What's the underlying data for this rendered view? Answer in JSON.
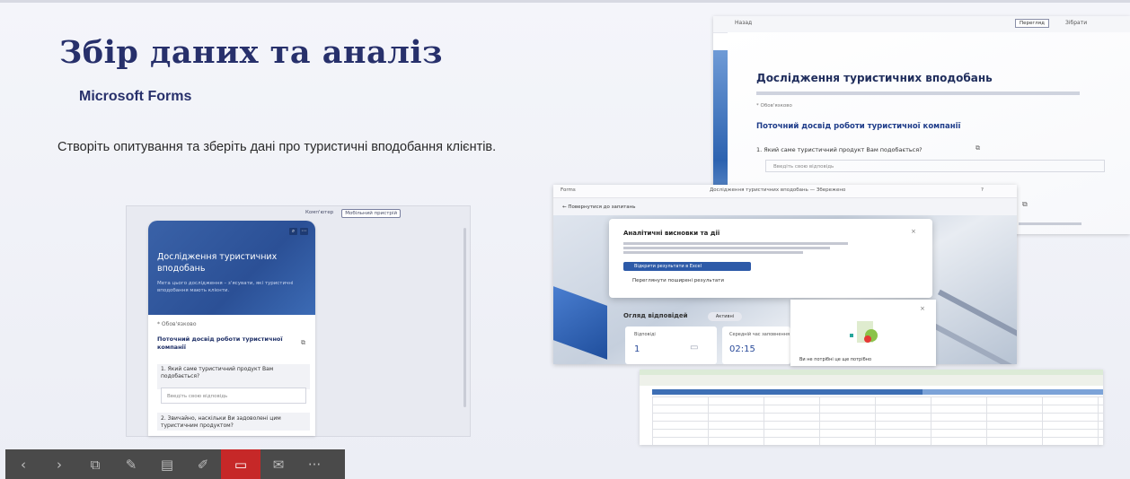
{
  "slide": {
    "title": "Збір даних та аналіз",
    "subtitle": "Microsoft Forms",
    "body": "Створіть опитування та зберіть дані про туристичні вподобання клієнтів."
  },
  "phone_preview": {
    "tab_computer": "Комп'ютер",
    "tab_mobile": "Мобільний пристрій",
    "form_title": "Дослідження туристичних вподобань",
    "form_desc": "Мета цього дослідження – з'ясувати, які туристичні вподобання мають клієнти.",
    "required_note": "* Обов'язково",
    "section_title": "Поточний досвід роботи туристичної компанії",
    "q1": "1. Який саме туристичний продукт Вам подобається?",
    "answer_placeholder": "Введіть свою відповідь",
    "q2": "2. Звичайно, наскільки Ви задоволені цим туристичним продуктом?"
  },
  "form_screenshot": {
    "top_left": "Назад",
    "preview_button": "Перегляд",
    "top_right": "Зібрати",
    "title": "Дослідження туристичних вподобань",
    "required_note": "* Обов'язково",
    "section_title": "Поточний досвід роботи туристичної компанії",
    "q1": "1. Який саме туристичний продукт Вам подобається?",
    "answer_placeholder": "Введіть свою відповідь"
  },
  "dashboard": {
    "top_left": "Forms",
    "top_mid": "Дослідження туристичних вподобань — Збережено",
    "top_right": "?",
    "back_link": "← Повернутися до запитань",
    "popup_title": "Аналітичні висновки та дії",
    "popup_button": "Відкрити результати в Excel",
    "popup_link": "Переглянути поширені результати",
    "overview_title": "Огляд відповідей",
    "overview_pill": "Активні",
    "stat1_label": "Відповіді",
    "stat1_value": "1",
    "stat2_label": "Середній час заповнення",
    "stat2_value": "02:15",
    "mini_text": "Ви не потрібні це ще потрібно"
  },
  "toolbar": {
    "buttons": [
      {
        "name": "prev-slide",
        "glyph": "‹"
      },
      {
        "name": "next-slide",
        "glyph": "›"
      },
      {
        "name": "slides-view",
        "glyph": "⧉"
      },
      {
        "name": "pen-tool",
        "glyph": "✎"
      },
      {
        "name": "subtitles",
        "glyph": "▤"
      },
      {
        "name": "laser-pointer",
        "glyph": "✐"
      },
      {
        "name": "record-camera",
        "glyph": "▭"
      },
      {
        "name": "comment",
        "glyph": "✉"
      },
      {
        "name": "more-options",
        "glyph": "···"
      }
    ]
  }
}
